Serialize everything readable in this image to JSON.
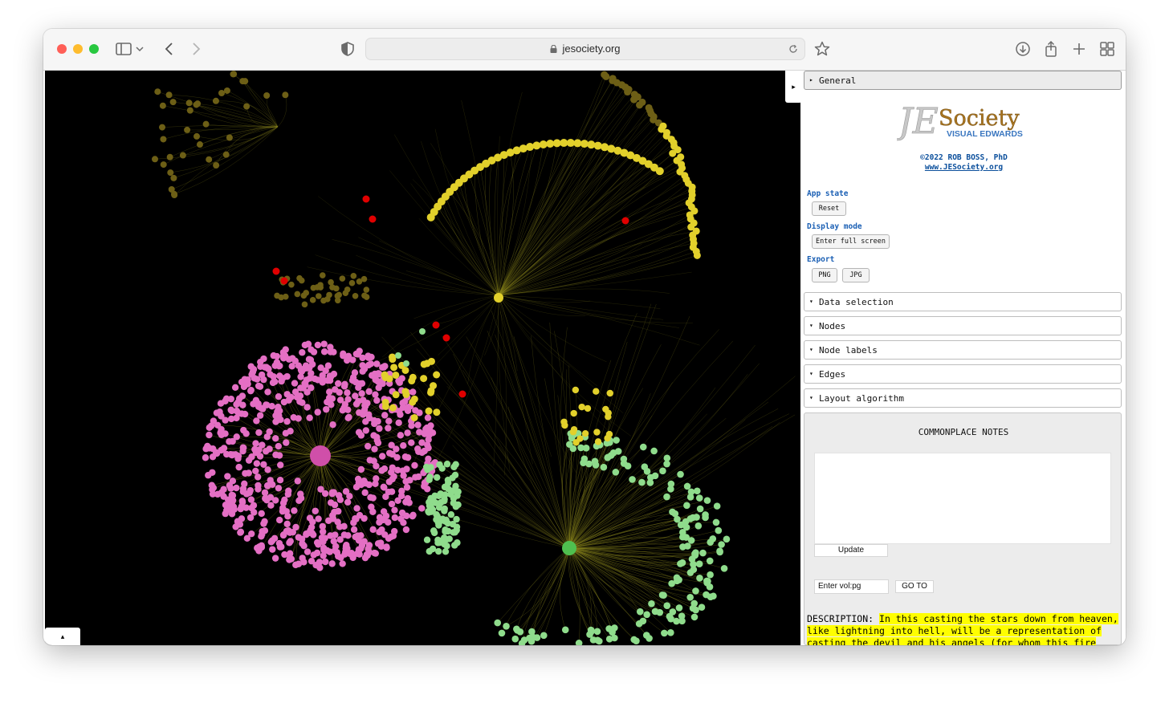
{
  "browser": {
    "url": "jesociety.org",
    "icons": [
      "sidebar-icon",
      "chevron-down-icon",
      "back-icon",
      "forward-icon",
      "shield-icon",
      "lock-icon",
      "reload-icon",
      "star-icon",
      "download-icon",
      "share-icon",
      "plus-icon",
      "tabs-grid-icon"
    ]
  },
  "graph": {
    "collapse_glyph": "▸",
    "up_glyph": "▴",
    "node_colors": {
      "gold": "#e2d02b",
      "dim_gold": "#6d5f16",
      "pink": "#e46fc4",
      "green": "#8fdc8c",
      "red": "#e00000",
      "edge": "#8f8a1c"
    }
  },
  "panel": {
    "general": {
      "arrow": "▸",
      "title": "General"
    },
    "logo": {
      "text": "Society",
      "subtitle": "VISUAL EDWARDS"
    },
    "credit": "©2022 ROB BOSS, PhD",
    "credit_link": "www.JESociety.org",
    "app_state": {
      "label": "App state",
      "reset": "Reset"
    },
    "display_mode": {
      "label": "Display mode",
      "fullscreen": "Enter full screen"
    },
    "export": {
      "label": "Export",
      "png": "PNG",
      "jpg": "JPG"
    },
    "folders": [
      {
        "arrow": "▾",
        "title": "Data selection"
      },
      {
        "arrow": "▾",
        "title": "Nodes"
      },
      {
        "arrow": "▾",
        "title": "Node labels"
      },
      {
        "arrow": "▾",
        "title": "Edges"
      },
      {
        "arrow": "▾",
        "title": "Layout algorithm"
      }
    ],
    "notes": {
      "title": "COMMONPLACE NOTES",
      "update": "Update",
      "vol_placeholder": "Enter vol:pg",
      "goto": "GO TO"
    },
    "description": {
      "label": "DESCRIPTION:",
      "text": "In this casting the stars down from heaven, like lightning into hell, will be a representation of casting the devil and his angels (for whom this fire will"
    }
  }
}
